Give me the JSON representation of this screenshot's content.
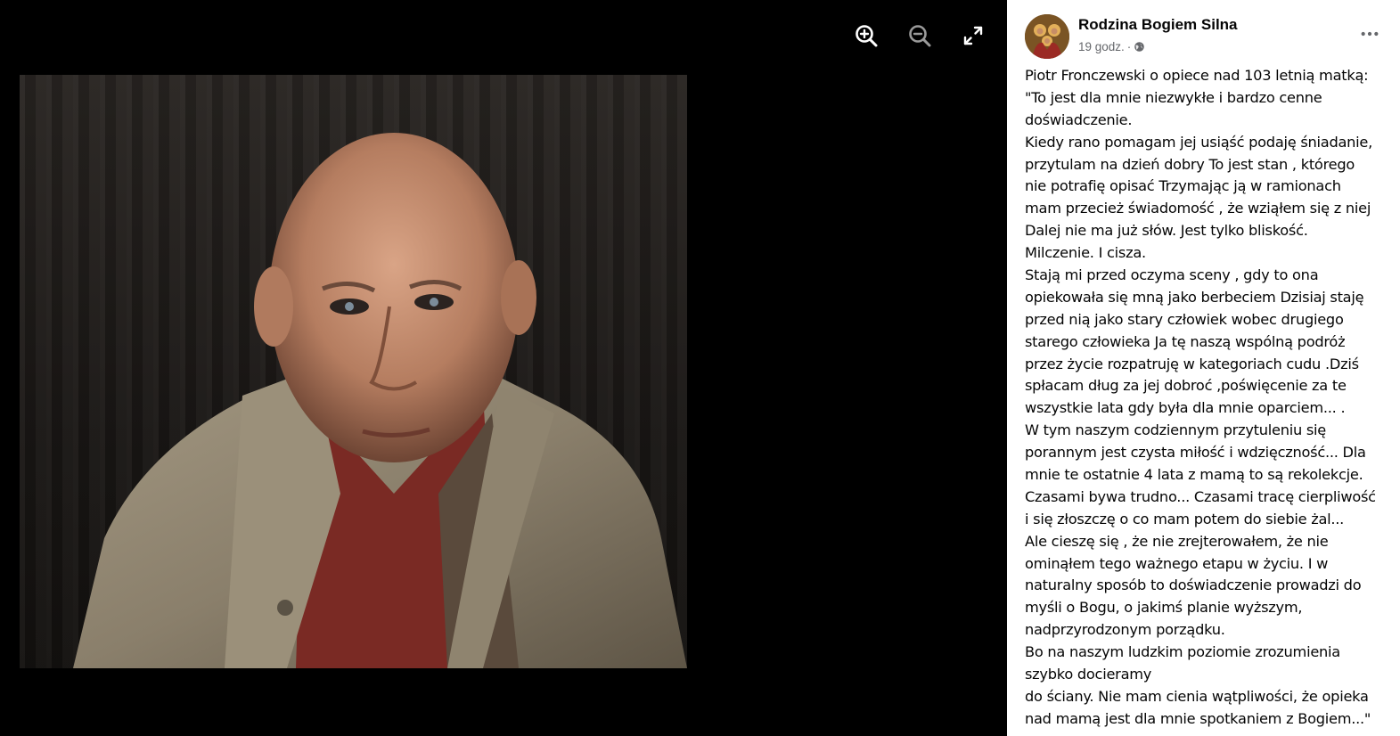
{
  "viewer": {
    "zoom_in_icon": "zoom-in-icon",
    "zoom_out_icon": "zoom-out-icon",
    "fullscreen_icon": "fullscreen-icon"
  },
  "post": {
    "page_name": "Rodzina Bogiem Silna",
    "time": "19 godz.",
    "separator": "·",
    "audience_icon": "globe-icon",
    "more_icon": "more-options-icon",
    "lines": [
      "Piotr Fronczewski o opiece nad 103 letnią matką:",
      "\"To jest dla mnie niezwykłe i bardzo cenne",
      "doświadczenie.",
      "Kiedy rano pomagam jej usiąść podaję śniadanie,",
      "przytulam na dzień dobry To jest stan , którego",
      "nie potrafię opisać Trzymając ją w ramionach",
      "mam przecież świadomość , że wziąłem się z niej",
      "Dalej nie ma już słów. Jest tylko bliskość.",
      "Milczenie. I cisza.",
      "Stają mi przed oczyma sceny , gdy to ona",
      "opiekowała się mną jako berbeciem Dzisiaj staję",
      "przed nią jako stary człowiek wobec drugiego",
      "starego człowieka Ja tę naszą wspólną podróż",
      "przez życie rozpatruję w kategoriach cudu .Dziś",
      "spłacam dług za jej dobroć ,poświęcenie za te",
      "wszystkie lata gdy była dla mnie oparciem... .",
      "W tym naszym codziennym przytuleniu się",
      "porannym jest czysta miłość i wdzięczność... Dla",
      "mnie te ostatnie 4 lata z mamą to są rekolekcje.",
      "Czasami bywa trudno... Czasami tracę cierpliwość",
      "i się złoszczę o co mam potem do siebie żal...",
      "Ale cieszę się , że nie zrejterowałem, że nie",
      "ominąłem tego ważnego etapu w życiu. I w",
      "naturalny sposób to doświadczenie prowadzi do",
      "myśli o Bogu, o jakimś planie wyższym,",
      "nadprzyrodzonym porządku.",
      "Bo na naszym ludzkim poziomie zrozumienia",
      "szybko docieramy",
      "do ściany. Nie mam cienia wątpliwości, że opieka",
      "nad mamą jest dla mnie spotkaniem z Bogiem...\""
    ]
  },
  "colors": {
    "viewer_bg": "#000000",
    "panel_bg": "#ffffff",
    "text": "#050505",
    "secondary_text": "#65676b"
  }
}
